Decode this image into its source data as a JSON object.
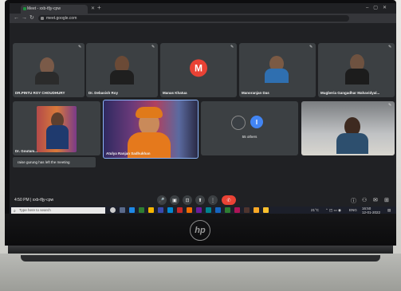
{
  "browser": {
    "tab_title": "Meet - xxb-tfjy-cpw",
    "url": "meet.google.com"
  },
  "participants": [
    {
      "name": "DR.PINTU ROY CHOUDHURY"
    },
    {
      "name": "Dr. Debasish Roy"
    },
    {
      "name": "Manas Khatua",
      "avatar_letter": "M"
    },
    {
      "name": "Manoranjan Das"
    },
    {
      "name": "Mugberia Gangadhar Mahavidyal..."
    },
    {
      "name": "Dr. Goutam..."
    },
    {
      "name": "Atulya Ranjan Sadhukhan"
    },
    {
      "name": "55 others",
      "avatar_letter": "I"
    },
    {
      "name": ""
    }
  ],
  "toast": "raise gurung has left the meeting",
  "meeting_info": "4:50 PM  |  xxb-tfjy-cpw",
  "taskbar": {
    "search_placeholder": "Type here to search",
    "weather": "21°C",
    "language": "ENG",
    "time": "16:50",
    "date": "12-01-2022"
  },
  "device_brand": "hp",
  "colors": {
    "meet_bg": "#202124",
    "tile_bg": "#3c4043",
    "end_call": "#ea4335",
    "avatar_red": "#e94235",
    "avatar_blue": "#4285f4"
  }
}
